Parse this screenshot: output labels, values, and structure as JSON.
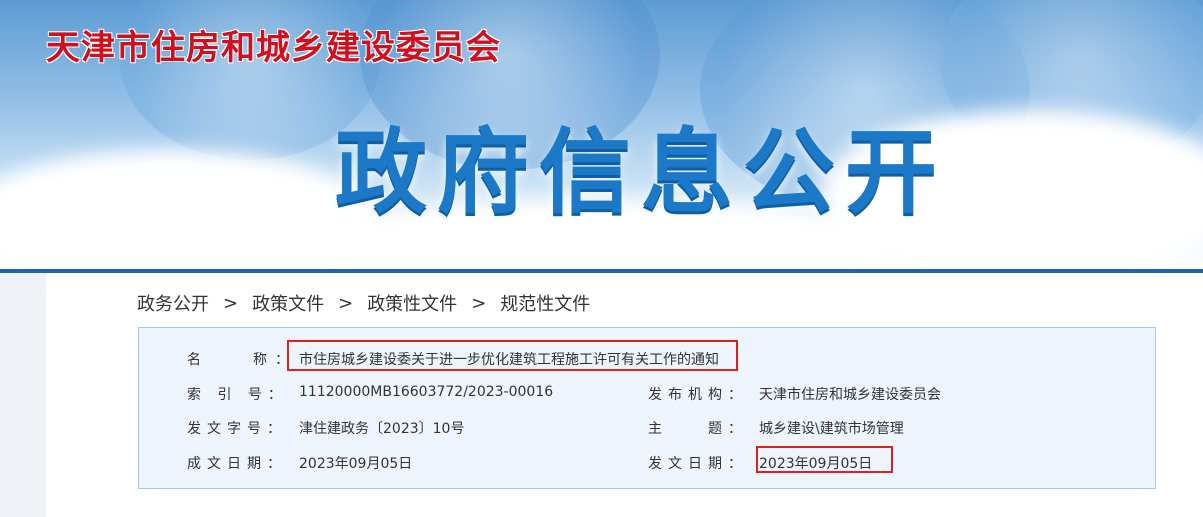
{
  "header": {
    "site_title": "天津市住房和城乡建设委员会",
    "hero_title": "政府信息公开"
  },
  "breadcrumb": {
    "items": [
      "政务公开",
      "政策文件",
      "政策性文件",
      "规范性文件"
    ],
    "separator": ">"
  },
  "document": {
    "name_label": "名　　称：",
    "name_value": "市住房城乡建设委关于进一步优化建筑工程施工许可有关工作的通知",
    "index_label": "索 引 号：",
    "index_value": "11120000MB16603772/2023-00016",
    "publisher_label": "发布机构：",
    "publisher_value": "天津市住房和城乡建设委员会",
    "docnum_label": "发文字号：",
    "docnum_value": "津住建政务〔2023〕10号",
    "subject_label": "主　　题：",
    "subject_value": "城乡建设\\建筑市场管理",
    "created_label": "成文日期：",
    "created_value": "2023年09月05日",
    "issued_label": "发文日期：",
    "issued_value": "2023年09月05日"
  },
  "colors": {
    "site_title": "#d0101e",
    "hero": "#1c79c8",
    "rule": "#1f64a8",
    "infobox_bg": "#edf4fc",
    "highlight": "#e0201a"
  }
}
